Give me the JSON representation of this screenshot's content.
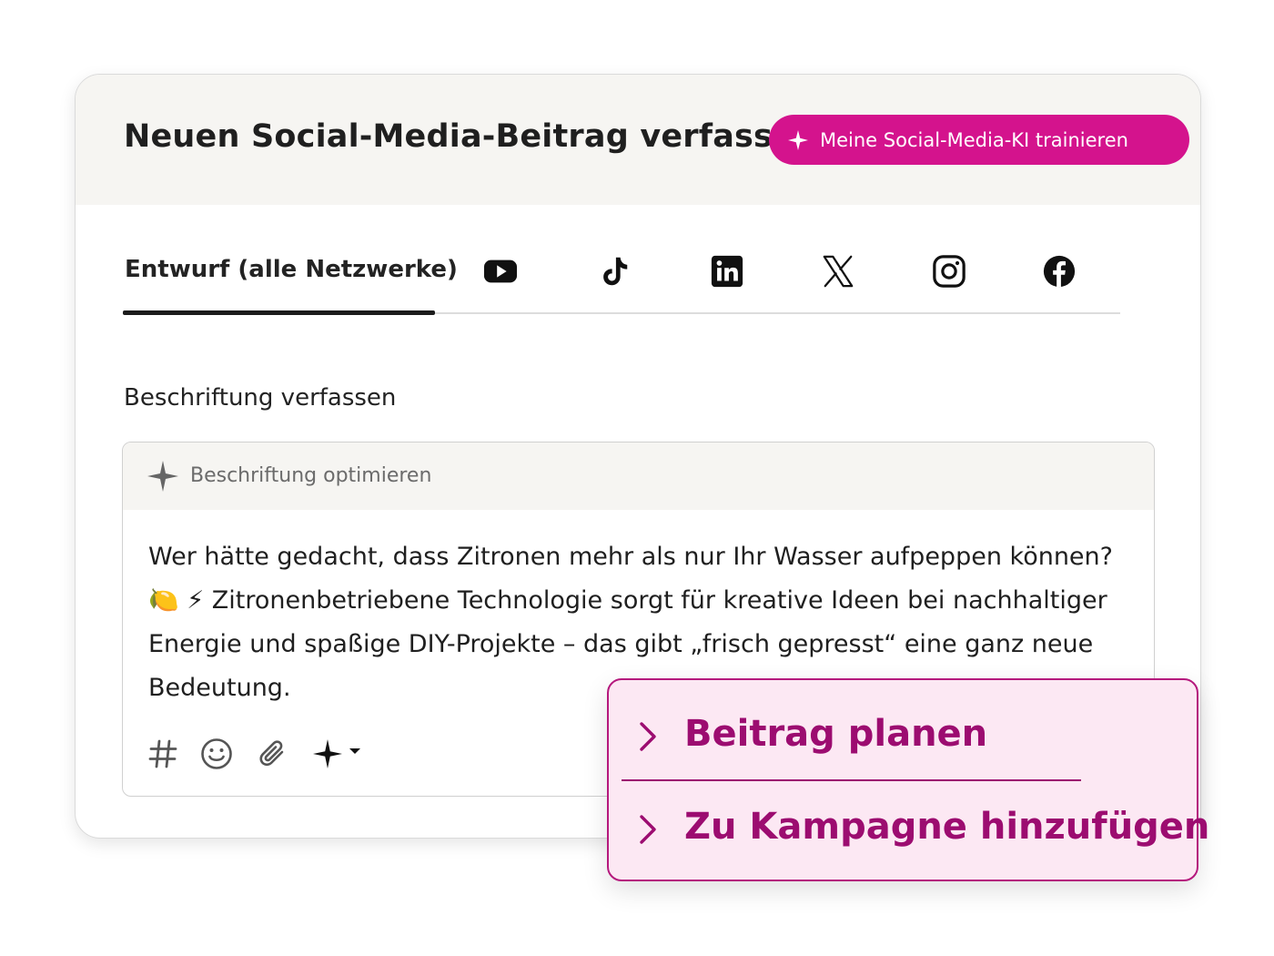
{
  "header": {
    "title": "Neuen Social-Media-Beitrag verfassen",
    "ki_button_label": "Meine Social-Media-KI trainieren",
    "ki_button_icon": "sparkle-icon"
  },
  "tabs": {
    "draft_label": "Entwurf (alle Netzwerke)",
    "networks": [
      "youtube-icon",
      "tiktok-icon",
      "linkedin-icon",
      "x-icon",
      "instagram-icon",
      "facebook-icon"
    ]
  },
  "composer": {
    "section_label": "Beschriftung verfassen",
    "optimize_label": "Beschriftung optimieren",
    "caption_text": "Wer hätte gedacht, dass Zitronen mehr als nur Ihr Wasser aufpeppen können? 🍋 ⚡ Zitronenbetriebene Technologie sorgt für kreative Ideen bei nachhaltiger Energie und spaßige DIY-Projekte – das gibt „frisch gepresst“ eine ganz neue Bedeutung.",
    "toolbar_icons": [
      "hashtag-icon",
      "emoji-icon",
      "paperclip-icon",
      "ai-sparkle-icon"
    ]
  },
  "popup": {
    "items": [
      {
        "label": "Beitrag planen",
        "icon": "chevron-right-icon"
      },
      {
        "label": "Zu Kampagne hinzufügen",
        "icon": "chevron-right-icon"
      }
    ]
  },
  "colors": {
    "accent": "#d4138d",
    "popup_text": "#9c0c70",
    "popup_bg": "#fce8f3",
    "header_bg": "#f6f5f2"
  }
}
